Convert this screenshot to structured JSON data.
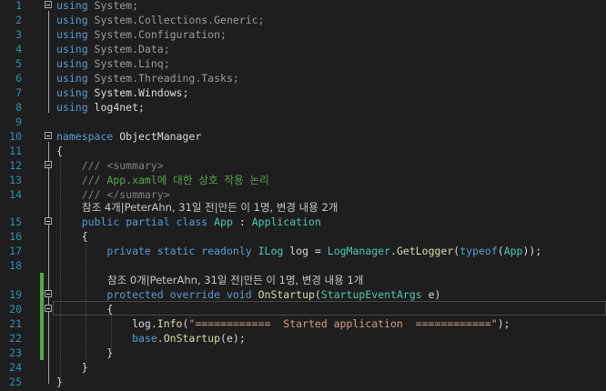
{
  "editor": {
    "lines": [
      {
        "n": "1",
        "tokens": [
          [
            "kw",
            "using"
          ],
          [
            "gray",
            " System;"
          ]
        ]
      },
      {
        "n": "2",
        "tokens": [
          [
            "kw",
            "using"
          ],
          [
            "gray",
            " System.Collections.Generic;"
          ]
        ]
      },
      {
        "n": "3",
        "tokens": [
          [
            "kw",
            "using"
          ],
          [
            "gray",
            " System.Configuration;"
          ]
        ]
      },
      {
        "n": "4",
        "tokens": [
          [
            "kw",
            "using"
          ],
          [
            "gray",
            " System.Data;"
          ]
        ]
      },
      {
        "n": "5",
        "tokens": [
          [
            "kw",
            "using"
          ],
          [
            "gray",
            " System.Linq;"
          ]
        ]
      },
      {
        "n": "6",
        "tokens": [
          [
            "kw",
            "using"
          ],
          [
            "gray",
            " System.Threading.Tasks;"
          ]
        ]
      },
      {
        "n": "7",
        "tokens": [
          [
            "kw",
            "using"
          ],
          [
            "txt",
            " System.Windows;"
          ]
        ]
      },
      {
        "n": "8",
        "tokens": [
          [
            "kw",
            "using"
          ],
          [
            "txt",
            " log4net;"
          ]
        ]
      },
      {
        "n": "9",
        "tokens": []
      },
      {
        "n": "10",
        "tokens": [
          [
            "kw",
            "namespace"
          ],
          [
            "txt",
            " ObjectManager"
          ]
        ]
      },
      {
        "n": "11",
        "tokens": [
          [
            "txt",
            "{"
          ]
        ]
      },
      {
        "n": "12",
        "tokens": [
          [
            "cmx",
            "    /// "
          ],
          [
            "cmx",
            "<summary>"
          ]
        ]
      },
      {
        "n": "13",
        "tokens": [
          [
            "cmx",
            "    /// "
          ],
          [
            "cm",
            "App.xaml에 대한 상호 작용 논리"
          ]
        ]
      },
      {
        "n": "14",
        "tokens": [
          [
            "cmx",
            "    /// "
          ],
          [
            "cmx",
            "</summary>"
          ]
        ]
      },
      {
        "n": "15",
        "tokens": [
          [
            "txt",
            "    "
          ],
          [
            "kw",
            "public"
          ],
          [
            "txt",
            " "
          ],
          [
            "kw",
            "partial"
          ],
          [
            "txt",
            " "
          ],
          [
            "kw",
            "class"
          ],
          [
            "txt",
            " "
          ],
          [
            "ty",
            "App"
          ],
          [
            "txt",
            " : "
          ],
          [
            "ty",
            "Application"
          ]
        ]
      },
      {
        "n": "16",
        "tokens": [
          [
            "txt",
            "    {"
          ]
        ]
      },
      {
        "n": "17",
        "tokens": [
          [
            "txt",
            "        "
          ],
          [
            "kw",
            "private"
          ],
          [
            "txt",
            " "
          ],
          [
            "kw",
            "static"
          ],
          [
            "txt",
            " "
          ],
          [
            "kw",
            "readonly"
          ],
          [
            "txt",
            " "
          ],
          [
            "ty",
            "ILog"
          ],
          [
            "txt",
            " log = "
          ],
          [
            "ty",
            "LogManager"
          ],
          [
            "txt",
            "."
          ],
          [
            "fn",
            "GetLogger"
          ],
          [
            "txt",
            "("
          ],
          [
            "kw",
            "typeof"
          ],
          [
            "txt",
            "("
          ],
          [
            "ty",
            "App"
          ],
          [
            "txt",
            "));"
          ]
        ]
      },
      {
        "n": "18",
        "tokens": []
      },
      {
        "n": "19",
        "tokens": [
          [
            "txt",
            "        "
          ],
          [
            "kw",
            "protected"
          ],
          [
            "txt",
            " "
          ],
          [
            "kw",
            "override"
          ],
          [
            "txt",
            " "
          ],
          [
            "kw",
            "void"
          ],
          [
            "txt",
            " "
          ],
          [
            "fn",
            "OnStartup"
          ],
          [
            "txt",
            "("
          ],
          [
            "ty",
            "StartupEventArgs"
          ],
          [
            "txt",
            " e)"
          ]
        ]
      },
      {
        "n": "20",
        "tokens": [
          [
            "txt",
            "        {"
          ]
        ]
      },
      {
        "n": "21",
        "tokens": [
          [
            "txt",
            "            log."
          ],
          [
            "fn",
            "Info"
          ],
          [
            "txt",
            "("
          ],
          [
            "st",
            "\"============  Started application  ============\""
          ],
          [
            "txt",
            ");"
          ]
        ]
      },
      {
        "n": "22",
        "tokens": [
          [
            "txt",
            "            "
          ],
          [
            "kw",
            "base"
          ],
          [
            "txt",
            "."
          ],
          [
            "fn",
            "OnStartup"
          ],
          [
            "txt",
            "(e);"
          ]
        ]
      },
      {
        "n": "23",
        "tokens": [
          [
            "txt",
            "        }"
          ]
        ]
      },
      {
        "n": "24",
        "tokens": [
          [
            "txt",
            "    }"
          ]
        ]
      },
      {
        "n": "25",
        "tokens": [
          [
            "txt",
            "}"
          ]
        ]
      }
    ],
    "codelens": {
      "class_lens": "참조 4개|PeterAhn, 31일 전|만든 이 1명, 변경 내용 2개",
      "method_lens": "참조 0개|PeterAhn, 31일 전|만든 이 1명, 변경 내용 1개"
    }
  }
}
